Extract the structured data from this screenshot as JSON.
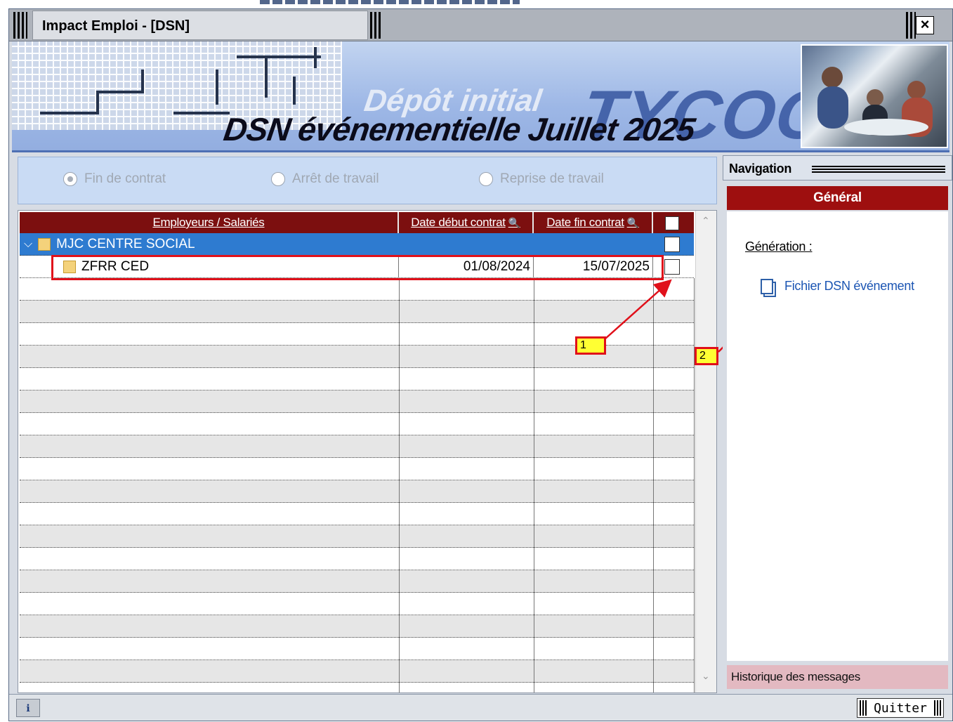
{
  "window": {
    "title": "Impact Emploi - [DSN]",
    "close_glyph": "×"
  },
  "banner": {
    "subtitle": "Dépôt initial",
    "headline": "DSN événementielle Juillet 2025",
    "brand": "TYCOON"
  },
  "radios": [
    {
      "label": "Fin de contrat",
      "selected": true
    },
    {
      "label": "Arrêt de travail",
      "selected": false
    },
    {
      "label": "Reprise de travail",
      "selected": false
    }
  ],
  "grid": {
    "headers": {
      "name": "Employeurs / Salariés",
      "start": "Date début contrat",
      "end": "Date fin contrat"
    },
    "rows": [
      {
        "name": "MJC CENTRE SOCIAL",
        "start": "",
        "end": "",
        "type": "employer",
        "checked": false
      },
      {
        "name": "ZFRR  CED",
        "start": "01/08/2024",
        "end": "15/07/2025",
        "type": "employee",
        "checked": false
      }
    ]
  },
  "callouts": {
    "one": "1",
    "two": "2"
  },
  "navigation": {
    "title": "Navigation",
    "section": "Général",
    "group_label": "Génération :",
    "link": "Fichier DSN événement",
    "footer": "Historique des messages"
  },
  "statusbar": {
    "quit_label": "Quitter",
    "icon": "info-icon"
  },
  "colors": {
    "header_red": "#7c0f0f",
    "selection_blue": "#2e7bd0",
    "highlight_red": "#e0101a",
    "callout_yellow": "#ffff33"
  }
}
